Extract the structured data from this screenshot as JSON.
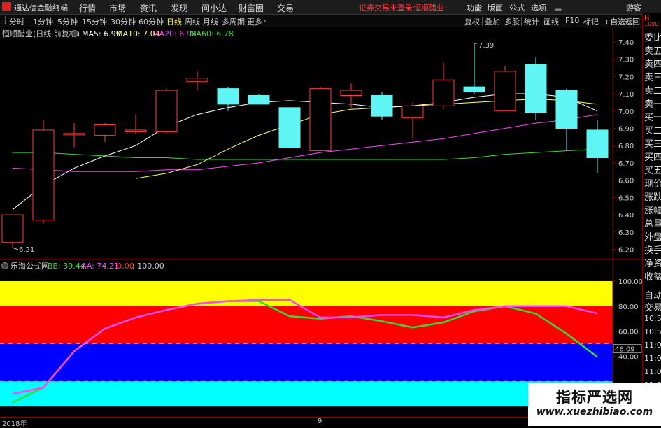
{
  "titlebar": {
    "app_name": "通达信金融终端",
    "menus": [
      "行情",
      "市场",
      "资讯",
      "发现",
      "问小达",
      "财富圈",
      "交易"
    ],
    "warning": "证券交易未登录",
    "stock_name": "恒顺醋业",
    "right_menus": [
      "功能",
      "版面",
      "公式",
      "选项"
    ],
    "user": "游客"
  },
  "toolbar": {
    "periods": [
      "分时",
      "1分钟",
      "5分钟",
      "15分钟",
      "30分钟",
      "60分钟",
      "日线",
      "周线",
      "月线",
      "多周期",
      "更多"
    ],
    "active_period": "日线",
    "buttons": [
      "复权",
      "叠加",
      "多股",
      "统计",
      "画线",
      "F10",
      "标记",
      "+自选",
      "返回"
    ]
  },
  "main_chart": {
    "title": "恒顺醋业(日线 前复权)",
    "ma_legends": [
      {
        "label": "MA5: 6.99",
        "color": "#ffffff"
      },
      {
        "label": "MA10: 7.04",
        "color": "#ffff66"
      },
      {
        "label": "MA20: 6.98",
        "color": "#ff44ff"
      },
      {
        "label": "MA60: 6.78",
        "color": "#33dd33"
      }
    ],
    "high_label": "7.39",
    "low_label": "6.21",
    "y_ticks": [
      "7.40",
      "7.30",
      "7.20",
      "7.10",
      "7.00",
      "6.90",
      "6.80",
      "6.70",
      "6.60",
      "6.50",
      "6.40",
      "6.30",
      "6.20"
    ]
  },
  "indicator": {
    "title": "乐淘公式网",
    "bb_label": "BB: 39.44",
    "aa_label": "AA: 74.21",
    "zero_label": ": 0.00",
    "hundred_label": ": 100.00",
    "y_ticks": [
      "100.00",
      "80.00",
      "60.00",
      "40.00"
    ],
    "current_value": "46.09",
    "colors": {
      "bb": "#33dd33",
      "aa": "#ff44ff",
      "band_top": "#ffff00",
      "band_red": "#ff0000",
      "band_blue": "#0000ff",
      "band_cyan": "#00ffff"
    }
  },
  "x_axis": {
    "year_label": "2018年",
    "month_label": "9"
  },
  "chart_data": {
    "type": "candlestick",
    "title": "恒顺醋业(日线 前复权)",
    "ylim": [
      6.17,
      7.46
    ],
    "candles": [
      {
        "o": 6.24,
        "c": 6.4,
        "h": 6.4,
        "l": 6.21
      },
      {
        "o": 6.37,
        "c": 6.89,
        "h": 6.95,
        "l": 6.35
      },
      {
        "o": 6.87,
        "c": 6.87,
        "h": 6.93,
        "l": 6.79
      },
      {
        "o": 6.86,
        "c": 6.92,
        "h": 6.93,
        "l": 6.82
      },
      {
        "o": 6.88,
        "c": 6.89,
        "h": 6.98,
        "l": 6.87
      },
      {
        "o": 6.88,
        "c": 7.12,
        "h": 7.13,
        "l": 6.87
      },
      {
        "o": 7.17,
        "c": 7.19,
        "h": 7.23,
        "l": 7.12
      },
      {
        "o": 7.13,
        "c": 7.04,
        "h": 7.14,
        "l": 7.0
      },
      {
        "o": 7.09,
        "c": 7.04,
        "h": 7.1,
        "l": 7.04
      },
      {
        "o": 7.02,
        "c": 6.79,
        "h": 7.02,
        "l": 6.79
      },
      {
        "o": 6.77,
        "c": 7.13,
        "h": 7.14,
        "l": 6.77
      },
      {
        "o": 7.09,
        "c": 7.12,
        "h": 7.16,
        "l": 7.02
      },
      {
        "o": 7.09,
        "c": 6.97,
        "h": 7.11,
        "l": 6.95
      },
      {
        "o": 6.96,
        "c": 7.03,
        "h": 7.05,
        "l": 6.84
      },
      {
        "o": 7.03,
        "c": 7.18,
        "h": 7.28,
        "l": 7.01
      },
      {
        "o": 7.14,
        "c": 7.11,
        "h": 7.39,
        "l": 7.1
      },
      {
        "o": 7.0,
        "c": 7.23,
        "h": 7.26,
        "l": 7.0
      },
      {
        "o": 7.27,
        "c": 6.99,
        "h": 7.31,
        "l": 6.95
      },
      {
        "o": 7.12,
        "c": 6.9,
        "h": 7.13,
        "l": 6.77
      },
      {
        "o": 6.89,
        "c": 6.73,
        "h": 6.95,
        "l": 6.64
      }
    ],
    "ma5": [
      6.43,
      6.57,
      6.67,
      6.74,
      6.8,
      6.91,
      6.98,
      7.02,
      7.05,
      7.06,
      7.05,
      7.04,
      7.02,
      7.03,
      7.05,
      7.08,
      7.1,
      7.1,
      7.08,
      7.0
    ],
    "ma10": [
      null,
      null,
      null,
      null,
      6.61,
      6.64,
      6.69,
      6.78,
      6.86,
      6.92,
      6.98,
      7.01,
      7.02,
      7.03,
      7.04,
      7.05,
      7.06,
      7.07,
      7.06,
      7.04
    ],
    "ma20": [
      6.67,
      6.66,
      6.65,
      6.65,
      6.65,
      6.66,
      6.66,
      6.68,
      6.7,
      6.73,
      6.76,
      6.78,
      6.8,
      6.82,
      6.84,
      6.87,
      6.9,
      6.93,
      6.95,
      6.98
    ],
    "ma60": [
      6.76,
      6.76,
      6.75,
      6.74,
      6.73,
      6.73,
      6.72,
      6.72,
      6.72,
      6.72,
      6.72,
      6.72,
      6.72,
      6.72,
      6.72,
      6.73,
      6.75,
      6.76,
      6.77,
      6.78
    ],
    "indicator": {
      "ylim": [
        0,
        100
      ],
      "bands": [
        100,
        80,
        50,
        20,
        0
      ],
      "BB": [
        3,
        15,
        44,
        62,
        71,
        77,
        82,
        84,
        84,
        72,
        70,
        72,
        68,
        63,
        67,
        76,
        80,
        74,
        58,
        39.44
      ],
      "AA": [
        10,
        15,
        44,
        62,
        71,
        77,
        82,
        84,
        85,
        85,
        71,
        71,
        73,
        73,
        71,
        77,
        80,
        80,
        80,
        74.21
      ]
    }
  },
  "watermark": {
    "cn": "指标严选网",
    "url": "www.xuezhibiao.com"
  },
  "right_panel": {
    "header": "B",
    "sub": "1000",
    "items": [
      "委比",
      "卖五",
      "卖四",
      "卖三",
      "卖二",
      "卖一",
      "买一",
      "买二",
      "买三",
      "买四",
      "买五",
      "现价",
      "涨跌",
      "涨幅",
      "总量",
      "外盘",
      "换手",
      "净资",
      "收益"
    ],
    "bottom_items": [
      "自动",
      "交易"
    ],
    "times": [
      "10:59",
      "10:59",
      "11:00",
      "11:00",
      "11:00",
      "11:00",
      "11:00"
    ]
  }
}
